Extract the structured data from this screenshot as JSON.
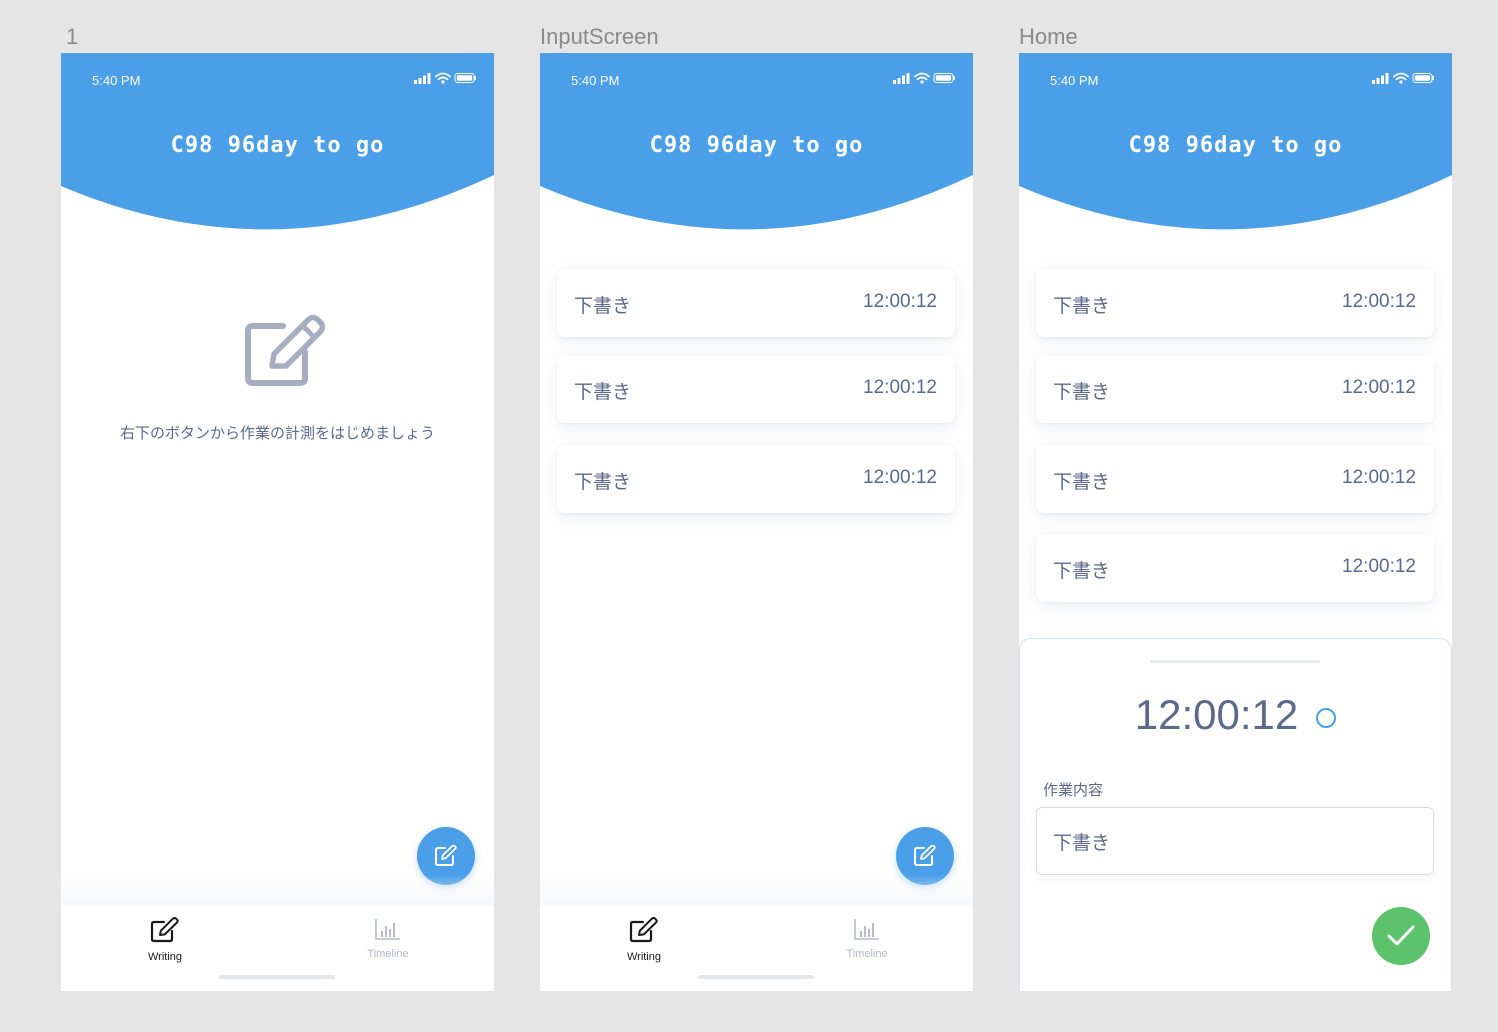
{
  "frames": [
    {
      "label": "1",
      "status_time": "5:40 PM",
      "app_title": "C98 96day to go",
      "empty_message": "右下のボタンから作業の計測をはじめましょう",
      "tabs": [
        {
          "label": "Writing",
          "active": true,
          "icon": "edit-icon"
        },
        {
          "label": "Timeline",
          "active": false,
          "icon": "bar-chart-icon"
        }
      ]
    },
    {
      "label": "InputScreen",
      "status_time": "5:40 PM",
      "app_title": "C98 96day to go",
      "entries": [
        {
          "title": "下書き",
          "time": "12:00:12"
        },
        {
          "title": "下書き",
          "time": "12:00:12"
        },
        {
          "title": "下書き",
          "time": "12:00:12"
        }
      ],
      "tabs": [
        {
          "label": "Writing",
          "active": true,
          "icon": "edit-icon"
        },
        {
          "label": "Timeline",
          "active": false,
          "icon": "bar-chart-icon"
        }
      ]
    },
    {
      "label": "Home",
      "status_time": "5:40 PM",
      "app_title": "C98 96day to go",
      "entries": [
        {
          "title": "下書き",
          "time": "12:00:12"
        },
        {
          "title": "下書き",
          "time": "12:00:12"
        },
        {
          "title": "下書き",
          "time": "12:00:12"
        },
        {
          "title": "下書き",
          "time": "12:00:12"
        }
      ],
      "sheet": {
        "timer": "12:00:12",
        "field_label": "作業内容",
        "field_value": "下書き",
        "confirm_icon": "check-icon"
      }
    }
  ],
  "colors": {
    "primary": "#4a9fe8",
    "text": "#5b6a8a",
    "success": "#5cc26b",
    "canvas": "#e5e5e5"
  }
}
